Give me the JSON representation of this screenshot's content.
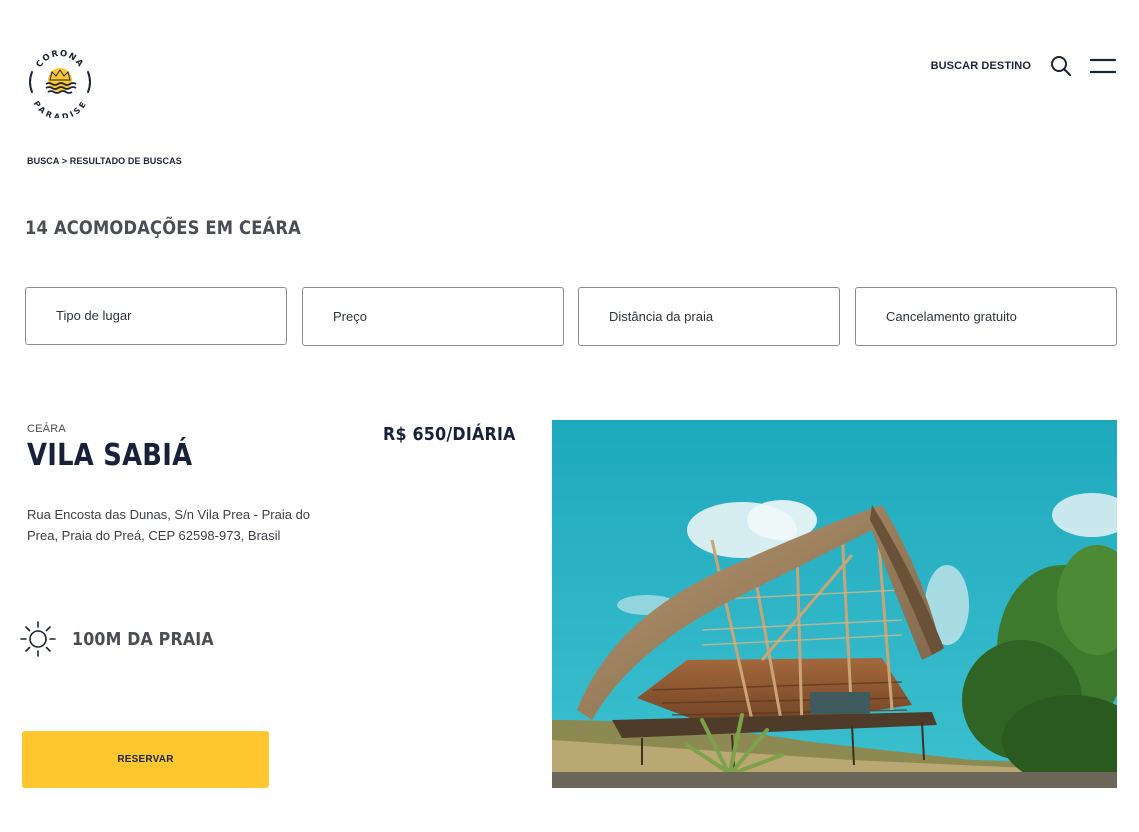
{
  "header": {
    "logo_text_top": "CORONA",
    "logo_text_bottom": "PARADISE",
    "nav_link": "BUSCAR DESTINO",
    "search_icon": "search-icon",
    "menu_icon": "hamburger-menu-icon"
  },
  "breadcrumb": {
    "text": "BUSCA > RESULTADO DE BUSCAS"
  },
  "results": {
    "title": "14 ACOMODAÇÕES EM CEÁRA"
  },
  "filters": [
    {
      "label": "Tipo de lugar"
    },
    {
      "label": "Preço"
    },
    {
      "label": "Distância da praia"
    },
    {
      "label": "Cancelamento gratuito"
    }
  ],
  "listing": {
    "region": "CEÁRA",
    "name": "VILA SABIÁ",
    "price": "R$ 650/DIÁRIA",
    "address": "Rua Encosta das Dunas, S/n Vila Prea - Praia do Prea, Praia do Preá, CEP 62598-973, Brasil",
    "beach_icon": "sun-icon",
    "beach_distance": "100M DA PRAIA",
    "reserve_label": "RESERVAR"
  },
  "colors": {
    "accent": "#fec72e",
    "primary_text": "#1c2437",
    "sky": "#2ab4c6"
  }
}
